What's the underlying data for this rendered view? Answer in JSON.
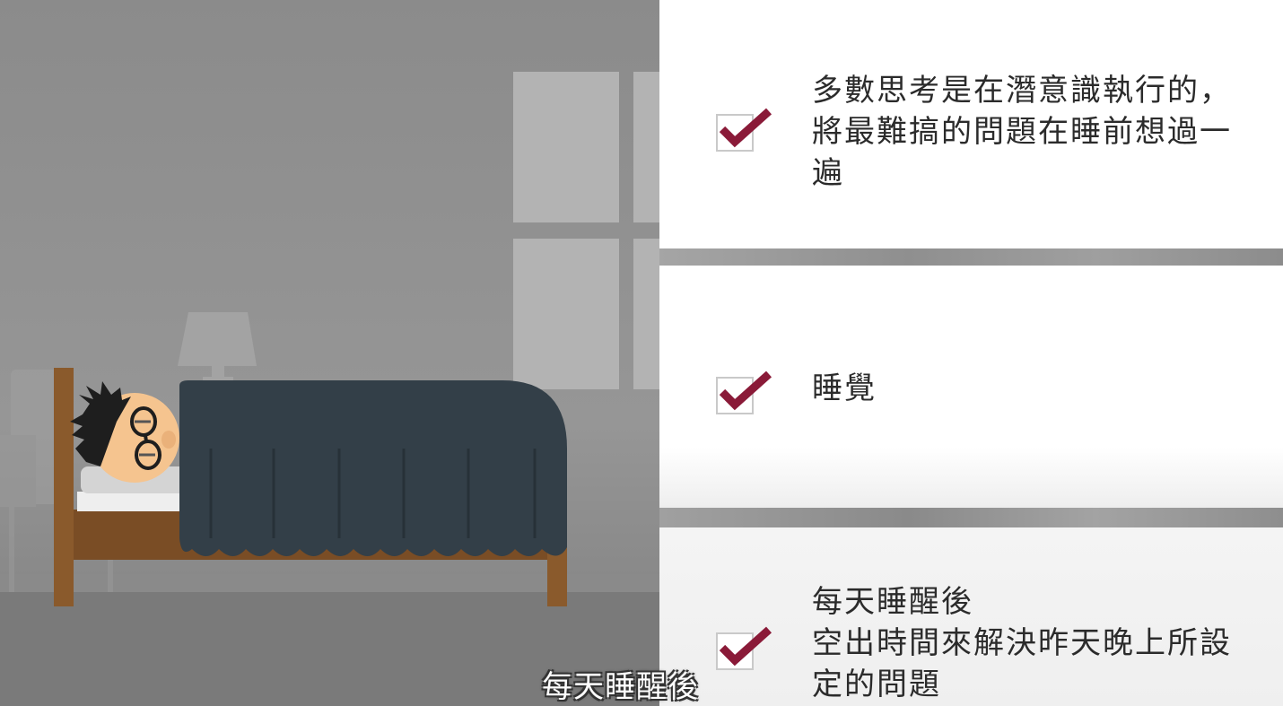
{
  "checklist": {
    "items": [
      {
        "text": "多數思考是在潛意識執行的，\n將最難搞的問題在睡前想過一\n遍",
        "checked": true
      },
      {
        "text": "睡覺",
        "checked": true
      },
      {
        "text": "每天睡醒後\n空出時間來解決昨天晚上所設\n定的問題",
        "checked": true
      }
    ],
    "check_color": "#8a1a38"
  },
  "subtitle": {
    "text": "每天睡醒後"
  },
  "colors": {
    "blanket": "#333f48",
    "bed_wood": "#8a5a2c",
    "background": "#8e8e8e"
  }
}
